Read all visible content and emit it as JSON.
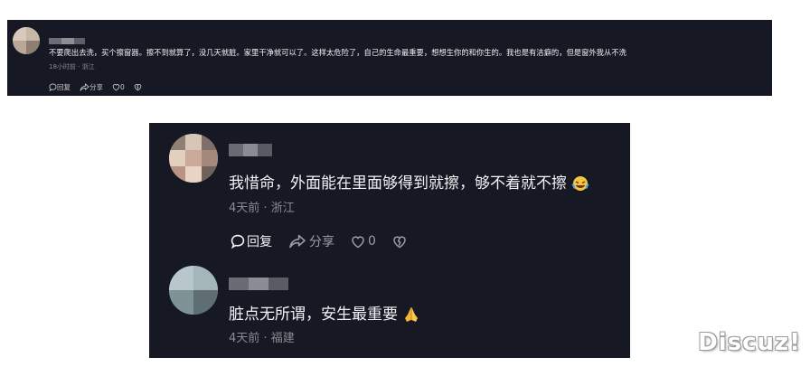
{
  "comments_top": {
    "comment1": {
      "text": "不要爬出去洗，买个擦窗器。擦不到就算了，没几天就脏。家里干净就可以了。这样太危险了，自己的生命最重要，想想生你的和你生的。我也是有洁癖的，但是窗外我从不洗",
      "time": "18小时前",
      "separator": "·",
      "location": "浙江",
      "reply_label": "回复",
      "share_label": "分享",
      "like_count": "0"
    }
  },
  "comments_bottom": {
    "comment2": {
      "text": "我惜命，外面能在里面够得到就擦，够不着就不擦",
      "emoji": "laughing-with-tears",
      "time": "4天前",
      "separator": "·",
      "location": "浙江",
      "reply_label": "回复",
      "share_label": "分享",
      "like_count": "0"
    },
    "comment3": {
      "text": "脏点无所谓，安生最重要",
      "emoji": "folded-hands",
      "time": "4天前",
      "separator": "·",
      "location": "福建"
    }
  },
  "watermark": "Discuz!",
  "colors": {
    "panel_bg": "#161823",
    "text": "#f2f2f4",
    "meta": "#8a8b92"
  }
}
